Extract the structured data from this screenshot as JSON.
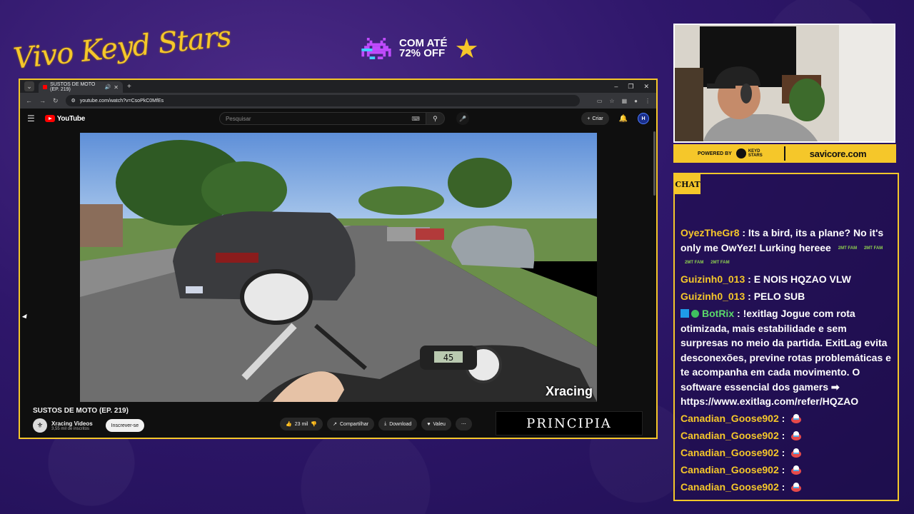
{
  "overlay": {
    "brand": "Vivo Keyd Stars",
    "promo_line1": "COM ATÉ",
    "promo_line2": "72% OFF"
  },
  "browser": {
    "tab_title": "SUSTOS DE MOTO (EP. 219)",
    "url": "youtube.com/watch?v=CsoPkC0MfEs"
  },
  "youtube": {
    "logo": "YouTube",
    "search_placeholder": "Pesquisar",
    "create_label": "Criar",
    "avatar_initial": "H"
  },
  "video": {
    "title": "SUSTOS DE MOTO (EP. 219)",
    "watermark": "Xracing",
    "speedometer": "45",
    "channel_name": "Xracing Videos",
    "subscribers": "3,55 mil de inscritos",
    "subscribe_label": "Inscrever-se",
    "likes": "23 mil",
    "share_label": "Compartilhar",
    "download_label": "Download",
    "thanks_label": "Valeu",
    "ad_text": "PRINCIPIA"
  },
  "sponsor": {
    "powered_by": "POWERED BY",
    "logo_text_1": "KEYD",
    "logo_text_2": "STARS",
    "partner": "savicore.com"
  },
  "chat": {
    "header": "CHAT",
    "emote_text": "2MT FAM",
    "messages": [
      {
        "user": "OyezTheGr8",
        "text": ": Its a bird, its a plane? No it's only me OwYez! Lurking hereee"
      },
      {
        "user": "Guizinh0_013",
        "text": ": E NOIS HQZAO VLW"
      },
      {
        "user": "Guizinh0_013",
        "text": ": PELO SUB"
      },
      {
        "user": "BotRix",
        "text": ": !exitlag Jogue com rota otimizada, mais estabilidade e sem surpresas no meio da partida. ExitLag evita desconexões, previne rotas problemáticas e te acompanha em cada movimento. O software essencial dos gamers ➡ https://www.exitlag.com/refer/HQZAO"
      },
      {
        "user": "Canadian_Goose902",
        "text": ":"
      },
      {
        "user": "Canadian_Goose902",
        "text": ":"
      },
      {
        "user": "Canadian_Goose902",
        "text": ":"
      },
      {
        "user": "Canadian_Goose902",
        "text": ":"
      },
      {
        "user": "Canadian_Goose902",
        "text": ":"
      }
    ]
  },
  "colors": {
    "accent": "#f5c72a",
    "background": "#2f176b",
    "bot": "#5bd96a"
  }
}
